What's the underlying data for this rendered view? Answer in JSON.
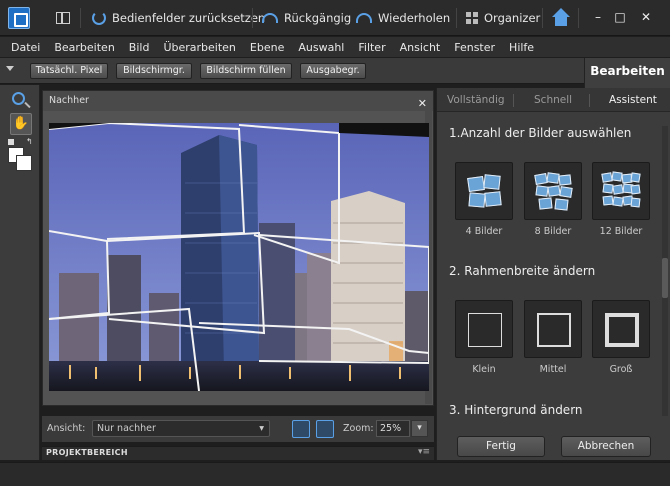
{
  "toolbar": {
    "reset_panels": "Bedienfelder zurücksetzen",
    "undo": "Rückgängig",
    "redo": "Wiederholen",
    "organizer": "Organizer",
    "minimize": "–",
    "maximize": "□",
    "close": "✕"
  },
  "menu": [
    "Datei",
    "Bearbeiten",
    "Bild",
    "Überarbeiten",
    "Ebene",
    "Auswahl",
    "Filter",
    "Ansicht",
    "Fenster",
    "Hilfe"
  ],
  "options": {
    "buttons": [
      "Tatsächl. Pixel",
      "Bildschirmgr.",
      "Bildschirm füllen",
      "Ausgabegr."
    ],
    "edit_tab": "Bearbeiten"
  },
  "document": {
    "title": "Nachher",
    "close": "✕"
  },
  "viewbar": {
    "view_label": "Ansicht:",
    "view_value": "Nur nachher",
    "zoom_label": "Zoom:",
    "zoom_value": "25%"
  },
  "project_bin": {
    "label": "PROJEKTBEREICH",
    "menu": "▾≡"
  },
  "panel": {
    "tabs": [
      "Vollständig",
      "Schnell",
      "Assistent"
    ],
    "active_tab": "Assistent",
    "step1": "1.Anzahl der Bilder auswählen",
    "count_options": [
      "4 Bilder",
      "8 Bilder",
      "12 Bilder"
    ],
    "step2": "2. Rahmenbreite ändern",
    "frame_options": [
      "Klein",
      "Mittel",
      "Groß"
    ],
    "step3": "3. Hintergrund ändern",
    "done": "Fertig",
    "cancel": "Abbrechen"
  },
  "colors": {
    "accent": "#5aa0e6",
    "sky": "#6b79c9",
    "background": "#3c3c3c"
  }
}
